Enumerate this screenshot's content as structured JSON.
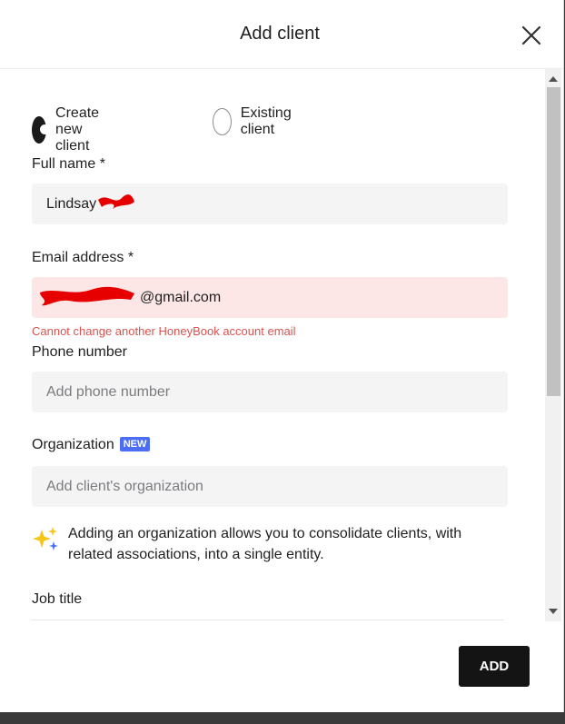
{
  "dialog": {
    "title": "Add client",
    "close_icon": "close-icon"
  },
  "client_type": {
    "options": [
      {
        "label": "Create new client",
        "selected": true
      },
      {
        "label": "Existing client",
        "selected": false
      }
    ]
  },
  "fields": {
    "full_name": {
      "label": "Full name *",
      "value": "Lindsay "
    },
    "email": {
      "label": "Email address *",
      "value": "@gmail.com",
      "error": "Cannot change another HoneyBook account email"
    },
    "phone": {
      "label": "Phone number",
      "placeholder": "Add phone number"
    },
    "organization": {
      "label": "Organization",
      "badge": "NEW",
      "placeholder": "Add client's organization"
    },
    "job_title": {
      "label": "Job title"
    }
  },
  "organization_info": {
    "icon": "sparkles-icon",
    "text": "Adding an organization allows you to consolidate clients, with related associations, into a single entity."
  },
  "footer": {
    "add_label": "ADD"
  },
  "colors": {
    "primary_button": "#141414",
    "error": "#d9534f",
    "error_bg": "#fde6e6",
    "badge": "#4c6ef5",
    "redaction": "#e60000"
  }
}
